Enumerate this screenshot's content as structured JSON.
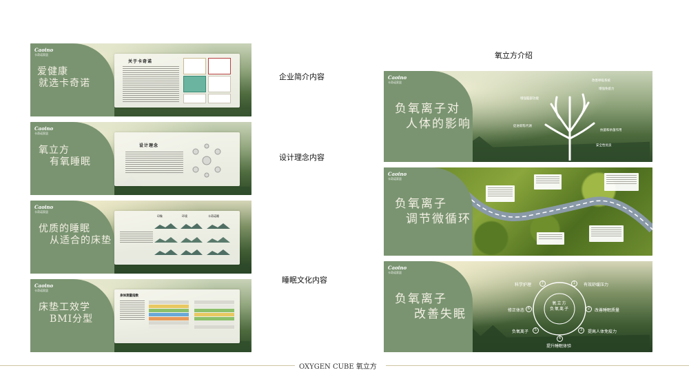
{
  "brand": {
    "name": "Caoino",
    "sub": "卡奇诺家居"
  },
  "labels": {
    "company_intro": "企业简介内容",
    "design_concept": "设计理念内容",
    "sleep_culture": "睡眠文化内容",
    "oxygen_intro": "氧立方介绍"
  },
  "footer": {
    "text": "OXYGEN CUBE 氧立方"
  },
  "panels_left": [
    {
      "title_line1": "爱健康",
      "title_line2": "就选卡奇诺",
      "card_title": "关于卡奇诺"
    },
    {
      "title_line1": "氧立方",
      "title_line2": "有氧睡眠",
      "card_title": "设计理念"
    },
    {
      "title_line1": "优质的睡眠",
      "title_line2": "从适合的床垫",
      "card_headers": [
        "印象",
        "环境",
        "卡奇诺睡"
      ]
    },
    {
      "title_line1": "床垫工效学",
      "title_line2": "BMI分型",
      "card_title": "身体测量指数"
    }
  ],
  "panels_right": [
    {
      "title_line1": "负氧离子对",
      "title_line2": "人体的影响",
      "callouts": [
        "改善呼吸系统",
        "增强免疫力",
        "增强脑部功能",
        "促进新陈代谢",
        "抗菌和杀菌作用",
        "安全性优良"
      ]
    },
    {
      "title_line1": "负氧离子",
      "title_line2": "调节微循环"
    },
    {
      "title_line1": "负氧离子",
      "title_line2": "改善失眠",
      "center_line1": "氧立方",
      "center_line2": "负氧离子",
      "steps": [
        {
          "num": "1",
          "label": "有效舒缓压力"
        },
        {
          "num": "2",
          "label": "改善睡眠质量"
        },
        {
          "num": "3",
          "label": "提高人体免疫力"
        },
        {
          "num": "4",
          "label": "提升睡眠体验"
        },
        {
          "num": "5",
          "label": "负氧离子"
        },
        {
          "num": "6",
          "label": "修正体态"
        },
        {
          "num": "7",
          "label": "科学护理"
        }
      ]
    }
  ]
}
